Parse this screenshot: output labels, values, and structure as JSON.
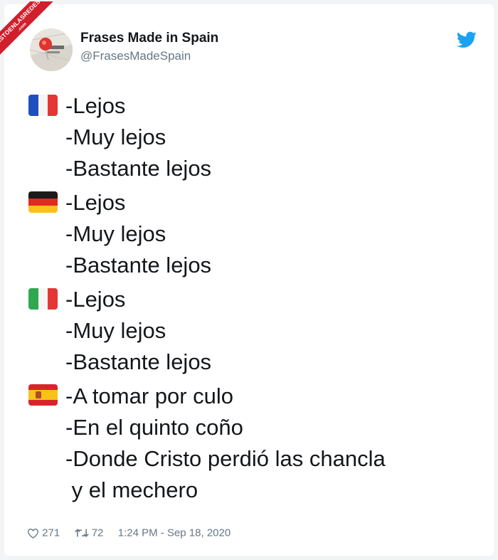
{
  "badge": {
    "text": "VISTOENLASREDES",
    "sub": ".com"
  },
  "tweet": {
    "author_name": "Frases Made in Spain",
    "author_handle": "@FrasesMadeSpain",
    "blocks": [
      {
        "flag": "france-flag-icon",
        "lines": [
          "-Lejos",
          "-Muy lejos",
          "-Bastante lejos"
        ]
      },
      {
        "flag": "germany-flag-icon",
        "lines": [
          "-Lejos",
          "-Muy lejos",
          "-Bastante lejos"
        ]
      },
      {
        "flag": "italy-flag-icon",
        "lines": [
          "-Lejos",
          "-Muy lejos",
          "-Bastante lejos"
        ]
      },
      {
        "flag": "spain-flag-icon",
        "lines": [
          "-A tomar por culo",
          "-En el quinto coño",
          "-Donde Cristo perdió las chancla",
          " y el mechero"
        ]
      }
    ],
    "likes": "271",
    "retweets": "72",
    "timestamp": "1:24 PM - Sep 18, 2020"
  },
  "colors": {
    "text": "#14171a",
    "secondary_text": "#657786",
    "twitter_blue": "#1da1f2",
    "badge_red": "#d11f2c"
  }
}
